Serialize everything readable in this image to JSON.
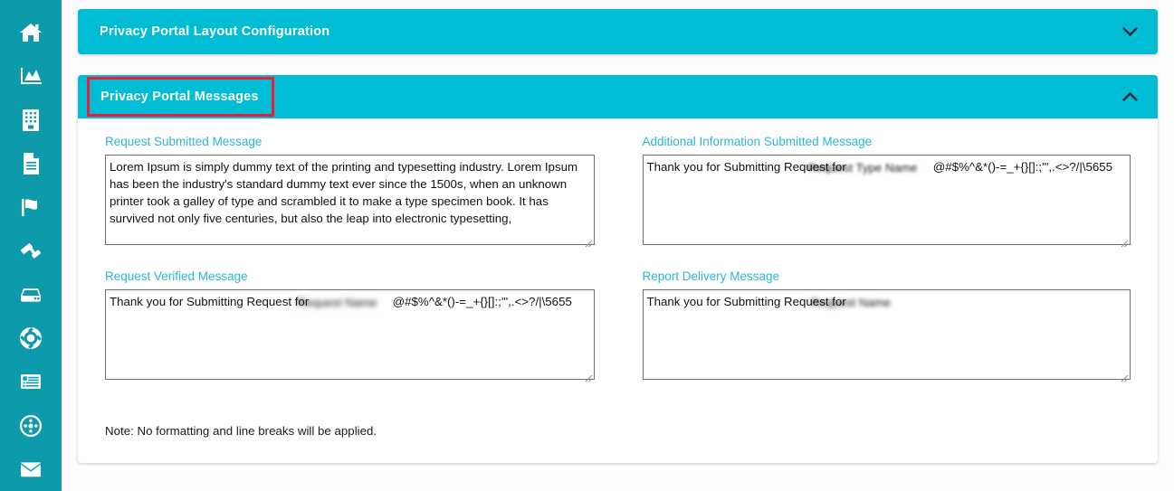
{
  "sidebar": {
    "items": [
      {
        "name": "home",
        "icon": "home-icon"
      },
      {
        "name": "analytics",
        "icon": "area-chart-icon"
      },
      {
        "name": "organization",
        "icon": "building-icon"
      },
      {
        "name": "documents",
        "icon": "document-icon"
      },
      {
        "name": "flags",
        "icon": "flag-icon"
      },
      {
        "name": "legal",
        "icon": "gavel-icon"
      },
      {
        "name": "storage",
        "icon": "hard-drive-icon"
      },
      {
        "name": "support",
        "icon": "life-ring-icon"
      },
      {
        "name": "records",
        "icon": "list-table-icon"
      },
      {
        "name": "discover",
        "icon": "compass-icon"
      },
      {
        "name": "messages",
        "icon": "envelope-icon"
      }
    ]
  },
  "panels": {
    "layout": {
      "title": "Privacy Portal Layout Configuration",
      "state": "collapsed",
      "chevron": "chevron-down-icon"
    },
    "messages": {
      "title": "Privacy Portal Messages",
      "state": "expanded",
      "chevron": "chevron-up-icon",
      "highlight_color": "#ed1c3a"
    }
  },
  "fields": {
    "request_submitted": {
      "label": "Request Submitted Message",
      "value": "Lorem Ipsum is simply dummy text of the printing and typesetting industry. Lorem Ipsum has been the industry's standard dummy text ever since the 1500s, when an unknown printer took a galley of type and scrambled it to make a type specimen book. It has survived not only five centuries, but also the leap into electronic typesetting,",
      "placeholder": ""
    },
    "additional_information_submitted": {
      "label": "Additional Information Submitted Message",
      "value": "Thank you for Submitting Request for                          @#$%^&*()-=_+{}[]:;'\",.<>?/|\\5655",
      "obscured_text": "Request Type Name",
      "placeholder": ""
    },
    "request_verified": {
      "label": "Request Verified Message",
      "value": "Thank you for Submitting Request for                         @#$%^&*()-=_+{}[]:;'\",.<>?/|\\5655",
      "obscured_text": "Request Name",
      "placeholder": ""
    },
    "report_delivery": {
      "label": "Report Delivery Message",
      "value": "Thank you for Submitting Request for",
      "obscured_text": "Request Name",
      "placeholder": ""
    }
  },
  "note": "Note: No formatting and line breaks will be applied.",
  "colors": {
    "sidebar": "#0d9aab",
    "panel_header": "#00bcd4",
    "label": "#2cb5d6",
    "highlight": "#ed1c3a",
    "scrollbar_thumb": "#1fc8e3"
  }
}
